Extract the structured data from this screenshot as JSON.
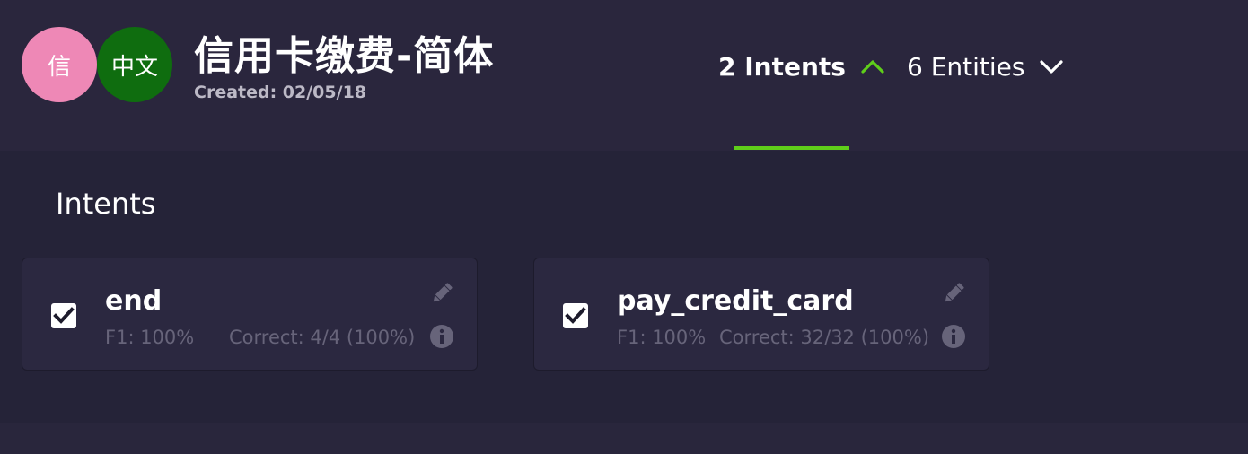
{
  "header": {
    "avatars": [
      {
        "text": "信",
        "color": "#ee88b6"
      },
      {
        "text": "中文",
        "color": "#0f6d0f"
      }
    ],
    "title": "信用卡缴费-简体",
    "created": "Created: 02/05/18",
    "tabs": [
      {
        "label": "2 Intents",
        "active": true,
        "chevron": "chevron-up-icon"
      },
      {
        "label": "6 Entities",
        "active": false,
        "chevron": "chevron-down-icon"
      }
    ],
    "accent_color": "#5fce1a"
  },
  "section": {
    "title": "Intents"
  },
  "intents": [
    {
      "name": "end",
      "f1": "F1: 100%",
      "correct": "Correct: 4/4 (100%)",
      "checked": true
    },
    {
      "name": "pay_credit_card",
      "f1": "F1: 100%",
      "correct": "Correct: 32/32 (100%)",
      "checked": true
    }
  ]
}
